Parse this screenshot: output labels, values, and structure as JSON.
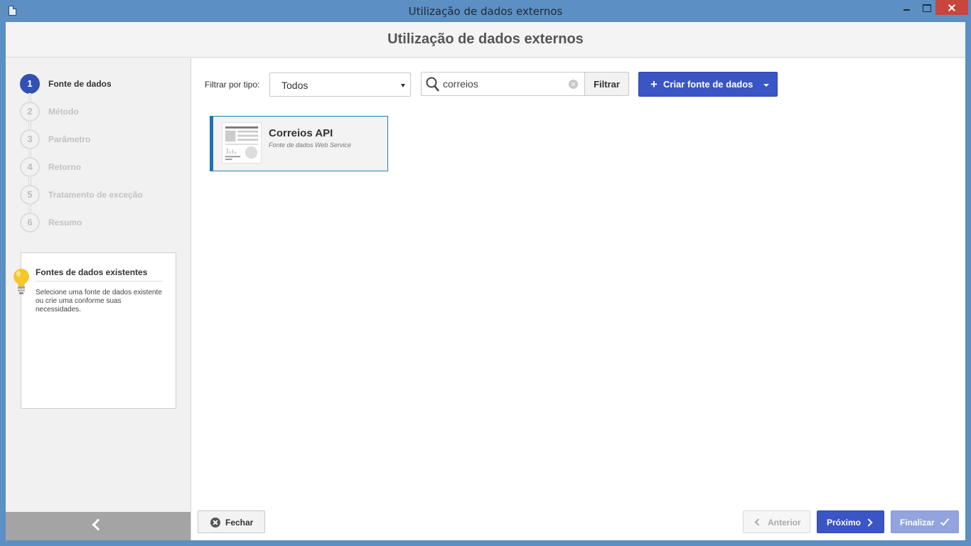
{
  "window": {
    "title": "Utilização de dados externos",
    "icons": [
      "document-icon",
      "minimize-icon",
      "maximize-icon",
      "close-icon"
    ]
  },
  "header": {
    "title": "Utilização de dados externos"
  },
  "steps": [
    {
      "number": "1",
      "label": "Fonte de dados",
      "active": true
    },
    {
      "number": "2",
      "label": "Método",
      "active": false
    },
    {
      "number": "3",
      "label": "Parâmetro",
      "active": false
    },
    {
      "number": "4",
      "label": "Retorno",
      "active": false
    },
    {
      "number": "5",
      "label": "Tratamento de exceção",
      "active": false
    },
    {
      "number": "6",
      "label": "Resumo",
      "active": false
    }
  ],
  "tip": {
    "title": "Fontes de dados existentes",
    "text": "Selecione uma fonte de dados existente ou crie uma conforme suas necessidades.",
    "icon": "lightbulb-icon"
  },
  "toolbar": {
    "filter_label": "Filtrar por tipo:",
    "type_selected": "Todos",
    "search_value": "correios",
    "filter_button": "Filtrar",
    "create_button": "Criar fonte de dados",
    "create_plus": "+"
  },
  "results": [
    {
      "name": "Correios API",
      "subtitle": "Fonte de dados Web Service",
      "selected": true
    }
  ],
  "footer": {
    "close": "Fechar",
    "previous": "Anterior",
    "next": "Próximo",
    "finish": "Finalizar"
  },
  "colors": {
    "titlebar": "#5c8fc3",
    "accent": "#3a55c4",
    "selected_border": "#1f72b8",
    "close_button": "#c7463d"
  }
}
